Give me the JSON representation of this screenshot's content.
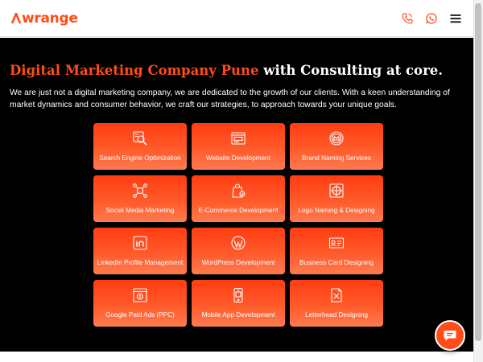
{
  "header": {
    "logo_text": "wrange",
    "icons": [
      "phone-icon",
      "whatsapp-icon",
      "menu-icon"
    ]
  },
  "hero": {
    "headline_orange": "Digital Marketing Company Pune",
    "headline_white": "with Consulting at core.",
    "intro": "We are just not a digital marketing company, we are dedicated to the growth of our clients. With a keen understanding of market dynamics and consumer behavior, we craft our strategies, to approach towards your unique goals."
  },
  "services": [
    {
      "label": "Search Engine Optimization",
      "icon": "seo-icon"
    },
    {
      "label": "Website Development",
      "icon": "website-icon"
    },
    {
      "label": "Brand Naming Services",
      "icon": "brand-icon"
    },
    {
      "label": "Social Media Marketing",
      "icon": "social-media-icon"
    },
    {
      "label": "E-Commerce Development",
      "icon": "ecommerce-icon"
    },
    {
      "label": "Logo Naming & Designing",
      "icon": "logo-design-icon"
    },
    {
      "label": "LinkedIn Profile Management",
      "icon": "linkedin-icon"
    },
    {
      "label": "WordPress Development",
      "icon": "wordpress-icon"
    },
    {
      "label": "Business Card Designing",
      "icon": "business-card-icon"
    },
    {
      "label": "Google Paid Ads (PPC)",
      "icon": "ppc-icon"
    },
    {
      "label": "Mobile App Development",
      "icon": "mobile-app-icon"
    },
    {
      "label": "Letterhead Designing",
      "icon": "letterhead-icon"
    }
  ],
  "colors": {
    "brand": "#ff4d1a",
    "background": "#000000",
    "card_top": "#ff3d12",
    "card_bottom": "#ff7b4f"
  }
}
